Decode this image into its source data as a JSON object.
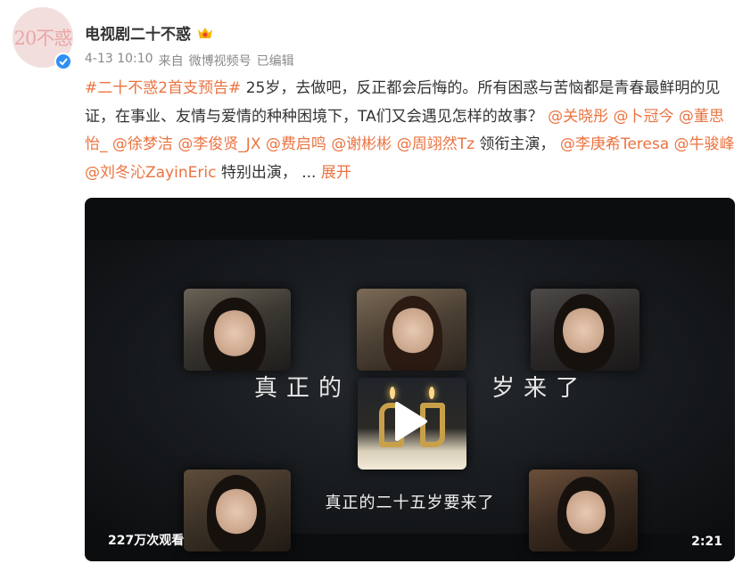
{
  "author": {
    "avatar_text": "20不惑",
    "name": "电视剧二十不惑",
    "crown_icon": "crown-icon",
    "verified_icon": "verified-badge-icon"
  },
  "meta": {
    "time": "4-13 10:10",
    "source_prefix": "来自",
    "source": "微博视频号",
    "edited": "已编辑"
  },
  "post": {
    "hashtag": "#二十不惑2首支预告#",
    "text1": " 25岁，去做吧，反正都会后悔的。所有困惑与苦恼都是青春最鲜明的见证，在事业、友情与爱情的种种困境下，TA们又会遇见怎样的故事？",
    "mentions_lead": [
      "@关晓彤",
      "@卜冠今",
      "@董思怡_",
      "@徐梦洁",
      "@李俊贤_JX",
      "@费启鸣",
      "@谢彬彬",
      "@周翊然Tz"
    ],
    "lead_suffix": " 领衔主演，",
    "mentions_special": [
      "@李庚希Teresa",
      "@牛骏峰",
      "@刘冬沁ZayinEric"
    ],
    "special_suffix": " 特别出演，",
    "ellipsis": "  ... ",
    "expand": "展开"
  },
  "video": {
    "overlay_left": "真正的",
    "overlay_right": "岁来了",
    "subtitle": "真正的二十五岁要来了",
    "views": "227万次观看",
    "duration": "2:21",
    "play_icon": "play-icon"
  },
  "colors": {
    "link": "#eb7340",
    "verified": "#2f8ff5",
    "meta": "#8a8a8a"
  }
}
